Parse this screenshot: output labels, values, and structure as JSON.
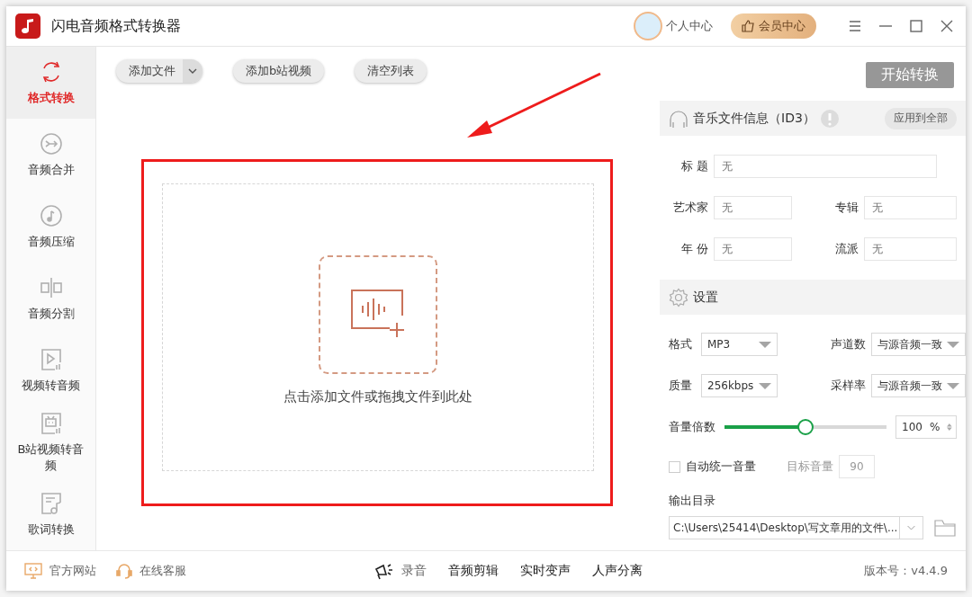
{
  "window": {
    "title": "闪电音频格式转换器"
  },
  "header": {
    "user_center": "个人中心",
    "vip_center": "会员中心"
  },
  "sidebar": {
    "items": [
      {
        "label": "格式转换",
        "selected": true,
        "kind": "convert"
      },
      {
        "label": "音频合并",
        "selected": false,
        "kind": "merge"
      },
      {
        "label": "音频压缩",
        "selected": false,
        "kind": "compress"
      },
      {
        "label": "音频分割",
        "selected": false,
        "kind": "split"
      },
      {
        "label": "视频转音频",
        "selected": false,
        "kind": "video"
      },
      {
        "label": "B站视频转音频",
        "selected": false,
        "kind": "tv"
      },
      {
        "label": "歌词转换",
        "selected": false,
        "kind": "lyrics"
      }
    ]
  },
  "toolbar": {
    "buttons": [
      {
        "label": "添加文件",
        "kind": "dropdown"
      },
      {
        "label": "添加b站视频",
        "kind": "plain"
      },
      {
        "label": "清空列表",
        "kind": "plain"
      }
    ],
    "start_button": "开始转换"
  },
  "drop_zone": {
    "hint": "点击添加文件或拖拽文件到此处"
  },
  "id3": {
    "title": "音乐文件信息（ID3）",
    "apply_all": "应用到全部",
    "fields": [
      {
        "label": "标 题",
        "placeholder": "无",
        "kind": "wide"
      },
      {
        "label": "艺术家",
        "placeholder": "无",
        "kind": "half"
      },
      {
        "label": "专辑",
        "placeholder": "无",
        "kind": "half"
      },
      {
        "label": "年 份",
        "placeholder": "无",
        "kind": "half"
      },
      {
        "label": "流派",
        "placeholder": "无",
        "kind": "half"
      }
    ]
  },
  "settings": {
    "title": "设置",
    "selects": [
      {
        "label": "格式",
        "value": "MP3"
      },
      {
        "label": "声道数",
        "value": "与源音频一致"
      },
      {
        "label": "质量",
        "value": "256kbps"
      },
      {
        "label": "采样率",
        "value": "与源音频一致"
      }
    ],
    "volume": {
      "label": "音量倍数",
      "level": 0.5,
      "value": "100",
      "unit": "%"
    },
    "auto_volume": {
      "label": "自动统一音量",
      "checked": false,
      "target_label": "目标音量",
      "target_value": "90"
    },
    "output": {
      "label": "输出目录",
      "path": "C:\\Users\\25414\\Desktop\\写文章用的文件\\..."
    }
  },
  "footer": {
    "links": [
      {
        "label": "官方网站",
        "kind": "website"
      },
      {
        "label": "在线客服",
        "kind": "support"
      }
    ],
    "tools": [
      {
        "label": "录音",
        "kind": "record"
      },
      {
        "label": "音频剪辑",
        "kind": "plain"
      },
      {
        "label": "实时变声",
        "kind": "plain"
      },
      {
        "label": "人声分离",
        "kind": "plain"
      }
    ],
    "version": "版本号：v4.4.9"
  }
}
